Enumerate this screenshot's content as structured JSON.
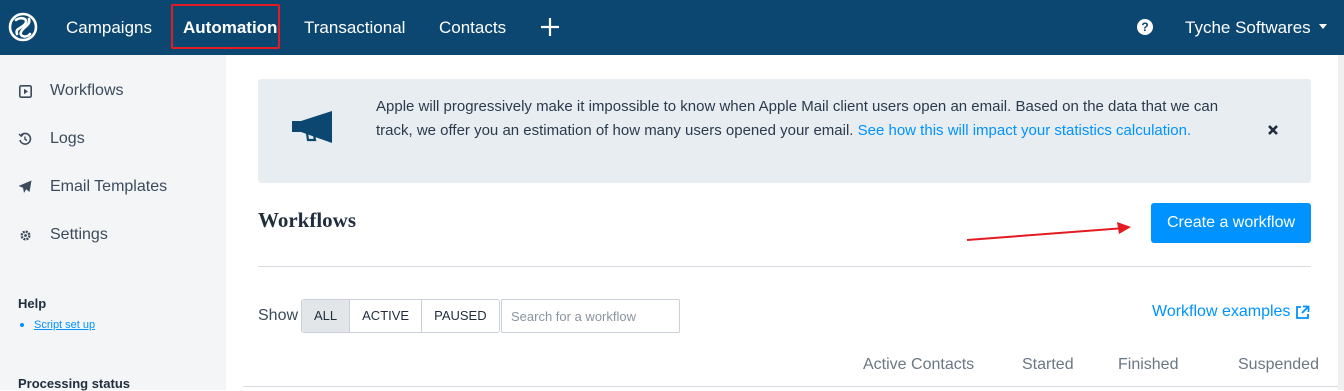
{
  "topnav": {
    "items": [
      {
        "label": "Campaigns"
      },
      {
        "label": "Automation",
        "active": true
      },
      {
        "label": "Transactional"
      },
      {
        "label": "Contacts"
      }
    ],
    "help_glyph": "?",
    "account_name": "Tyche Softwares"
  },
  "sidebar": {
    "items": [
      {
        "label": "Workflows",
        "icon": "play-square-icon"
      },
      {
        "label": "Logs",
        "icon": "history-icon"
      },
      {
        "label": "Email Templates",
        "icon": "paper-plane-icon"
      },
      {
        "label": "Settings",
        "icon": "gear-icon"
      }
    ],
    "help_heading": "Help",
    "help_link": "Script set up",
    "processing_heading": "Processing status"
  },
  "banner": {
    "text": "Apple will progressively make it impossible to know when Apple Mail client users open an email. Based on the data that we can track, we offer you an estimation of how many users opened your email. ",
    "link": "See how this will impact your statistics calculation."
  },
  "main": {
    "title": "Workflows",
    "create_button": "Create a workflow",
    "show_label": "Show",
    "filters": [
      "ALL",
      "ACTIVE",
      "PAUSED"
    ],
    "active_filter": "ALL",
    "search_placeholder": "Search for a workflow",
    "examples_link": "Workflow examples",
    "columns": [
      "Active Contacts",
      "Started",
      "Finished",
      "Suspended"
    ]
  },
  "colors": {
    "nav_bg": "#0b4771",
    "accent": "#0092ff",
    "highlight": "#e31b23",
    "banner_bg": "#e8edf2",
    "sidebar_bg": "#f4f5f7"
  }
}
